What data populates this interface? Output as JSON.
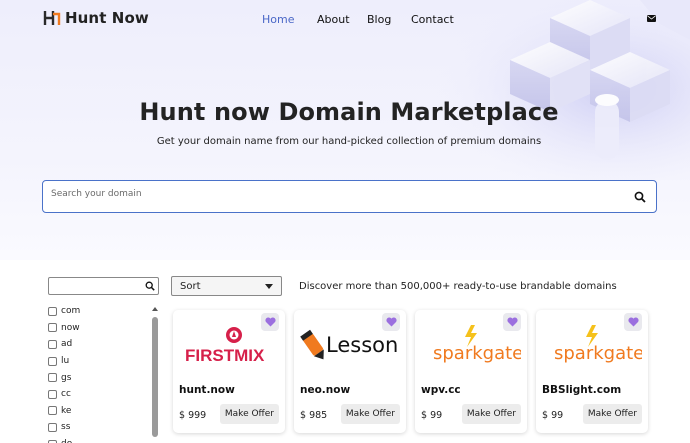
{
  "brand": {
    "name": "Hunt Now"
  },
  "nav": {
    "links": [
      {
        "label": "Home"
      },
      {
        "label": "About"
      },
      {
        "label": "Blog"
      },
      {
        "label": "Contact"
      }
    ]
  },
  "hero": {
    "title": "Hunt now Domain Marketplace",
    "subtitle": "Get your domain name from our hand-picked collection of premium domains",
    "search_placeholder": "Search your domain"
  },
  "filter": {
    "search_value": "",
    "tlds": [
      "com",
      "now",
      "ad",
      "lu",
      "gs",
      "cc",
      "ke",
      "ss",
      "do"
    ]
  },
  "sort": {
    "label": "Sort"
  },
  "discover_text": "Discover more than 500,000+ ready-to-use brandable domains",
  "cards": [
    {
      "logo_text": "FIRSTMIX",
      "name": "hunt.now",
      "price": "$ 999",
      "offer_label": "Make Offer"
    },
    {
      "logo_text": "Lesson",
      "name": "neo.now",
      "price": "$ 985",
      "offer_label": "Make Offer"
    },
    {
      "logo_text": "sparkgate",
      "name": "wpv.cc",
      "price": "$ 99",
      "offer_label": "Make Offer"
    },
    {
      "logo_text": "sparkgate",
      "name": "BBSlight.com",
      "price": "$ 99",
      "offer_label": "Make Offer"
    }
  ],
  "colors": {
    "accent": "#4a67c7",
    "heart": "#9b6fdf",
    "firstmix_red": "#d6204a",
    "firstmix_pink": "#e0208c",
    "spark_orange": "#f07a1f",
    "spark_teal": "#1a9fb3"
  },
  "icons": {
    "search": "search-icon",
    "mail": "mail-icon",
    "favorite": "heart-icon",
    "sort": "caret-down-icon"
  }
}
